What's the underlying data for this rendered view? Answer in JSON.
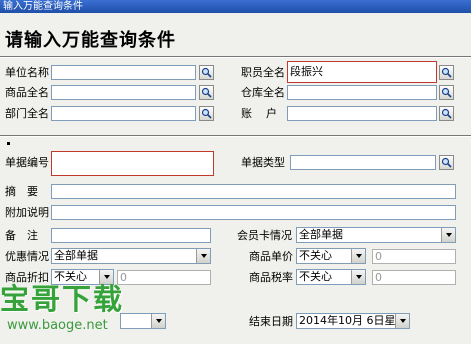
{
  "window": {
    "title": "输入万能查询条件"
  },
  "heading": "请输入万能查询条件",
  "fields": {
    "unit_name": {
      "label": "单位名称",
      "value": ""
    },
    "staff_name": {
      "label": "职员全名",
      "value": "段振兴"
    },
    "product_name": {
      "label": "商品全名",
      "value": ""
    },
    "warehouse_name": {
      "label": "仓库全名",
      "value": ""
    },
    "dept_name": {
      "label": "部门全名",
      "value": ""
    },
    "account": {
      "label": "账户",
      "value": ""
    },
    "doc_number": {
      "label": "单据编号",
      "value": ""
    },
    "doc_type": {
      "label": "单据类型",
      "value": ""
    },
    "summary": {
      "label": "摘要",
      "value": ""
    },
    "extra_note": {
      "label": "附加说明",
      "value": ""
    },
    "remark": {
      "label": "备注",
      "value": ""
    },
    "member_card": {
      "label": "会员卡情况",
      "value": "全部单据"
    },
    "discount": {
      "label": "优惠情况",
      "value": "全部单据"
    },
    "unit_price": {
      "label": "商品单价",
      "value": "不关心",
      "number": "0"
    },
    "product_discount": {
      "label": "商品折扣",
      "value": "不关心",
      "number": "0"
    },
    "tax_rate": {
      "label": "商品税率",
      "value": "不关心",
      "number": "0"
    },
    "end_date": {
      "label": "结束日期",
      "value": "2014年10月 6日星期"
    }
  },
  "watermark": {
    "text": "宝哥下载",
    "url": "www.baoge.net"
  },
  "icons": {
    "lookup": "magnifier-icon",
    "dropdown": "chevron-down-icon"
  }
}
